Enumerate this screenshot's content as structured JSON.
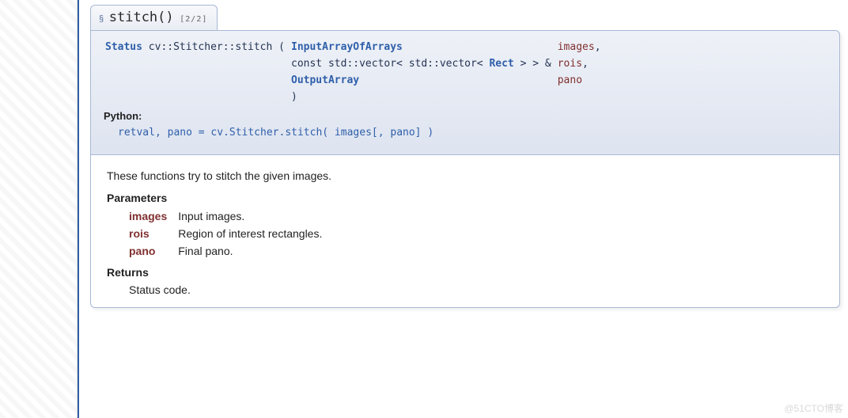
{
  "title": {
    "permalink_symbol": "§",
    "function_name": "stitch()",
    "overload": "[2/2]"
  },
  "signature": {
    "return_type": "Status",
    "qualified_name": "cv::Stitcher::stitch",
    "open_paren": "(",
    "close_paren": ")",
    "params": [
      {
        "type_prefix": "",
        "type_link": "InputArrayOfArrays",
        "type_suffix": "",
        "name": "images",
        "trailing": ","
      },
      {
        "type_prefix": "const std::vector< std::vector< ",
        "type_link": "Rect",
        "type_suffix": " > > &",
        "name": "rois",
        "trailing": ","
      },
      {
        "type_prefix": "",
        "type_link": "OutputArray",
        "type_suffix": "",
        "name": "pano",
        "trailing": ""
      }
    ]
  },
  "python": {
    "label": "Python:",
    "line": "retval, pano = cv.Stitcher.stitch( images[, pano] )"
  },
  "doc": {
    "description": "These functions try to stitch the given images.",
    "params_title": "Parameters",
    "params": [
      {
        "name": "images",
        "desc": "Input images."
      },
      {
        "name": "rois",
        "desc": "Region of interest rectangles."
      },
      {
        "name": "pano",
        "desc": "Final pano."
      }
    ],
    "returns_title": "Returns",
    "returns_body": "Status code."
  },
  "watermark": "@51CTO博客"
}
